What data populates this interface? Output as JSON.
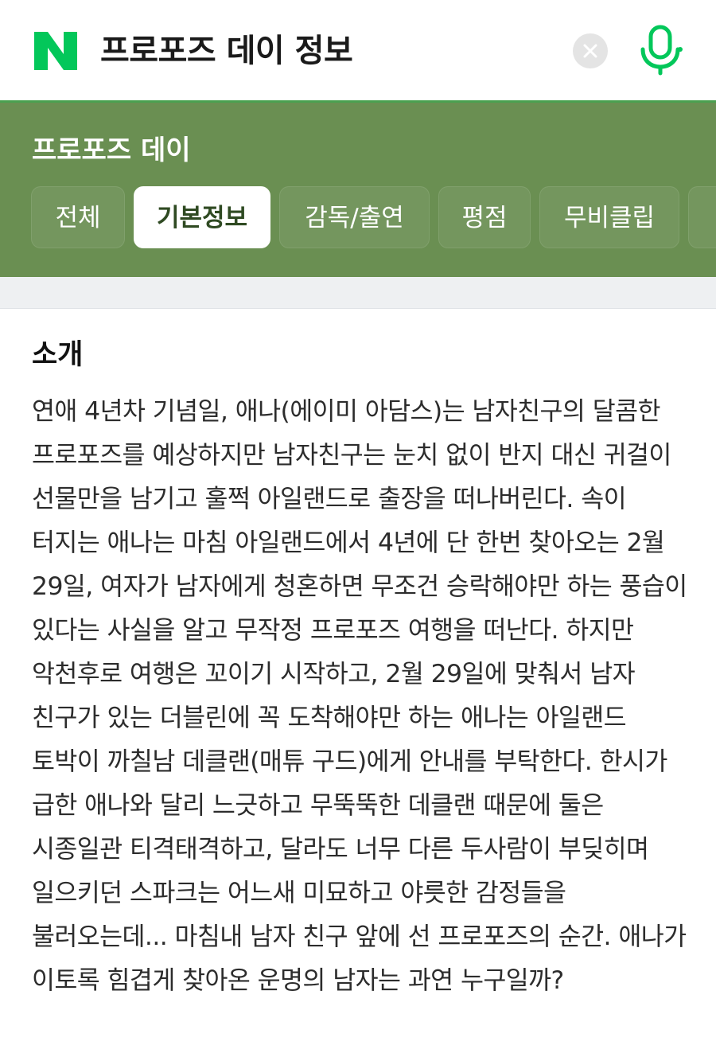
{
  "search": {
    "query": "프로포즈 데이 정보",
    "logo_icon": "naver-logo-icon",
    "brand_color": "#03c75a"
  },
  "movie": {
    "title": "프로포즈 데이",
    "header_color": "#6a8f52",
    "tabs": [
      {
        "label": "전체",
        "active": false
      },
      {
        "label": "기본정보",
        "active": true
      },
      {
        "label": "감독/출연",
        "active": false
      },
      {
        "label": "평점",
        "active": false
      },
      {
        "label": "무비클립",
        "active": false
      }
    ]
  },
  "intro": {
    "heading": "소개",
    "body": "연애 4년차 기념일, 애나(에이미 아담스)는 남자친구의 달콤한 프로포즈를 예상하지만 남자친구는 눈치 없이 반지 대신 귀걸이 선물만을 남기고 훌쩍 아일랜드로 출장을 떠나버린다. 속이 터지는 애나는 마침 아일랜드에서 4년에 단 한번 찾아오는 2월 29일, 여자가 남자에게 청혼하면 무조건 승락해야만 하는 풍습이 있다는 사실을 알고 무작정 프로포즈 여행을 떠난다. 하지만 악천후로 여행은 꼬이기 시작하고, 2월 29일에 맞춰서 남자 친구가 있는 더블린에 꼭 도착해야만 하는 애나는 아일랜드 토박이 까칠남 데클랜(매튜 구드)에게 안내를 부탁한다. 한시가 급한 애나와 달리 느긋하고 무뚝뚝한 데클랜 때문에 둘은 시종일관 티격태격하고, 달라도 너무 다른 두사람이 부딪히며 일으키던 스파크는 어느새 미묘하고 야릇한 감정들을 불러오는데... 마침내 남자 친구 앞에 선 프로포즈의 순간. 애나가 이토록 힘겹게 찾아온 운명의 남자는 과연 누구일까?"
  },
  "icons": {
    "clear": "close-icon",
    "voice": "microphone-icon"
  }
}
